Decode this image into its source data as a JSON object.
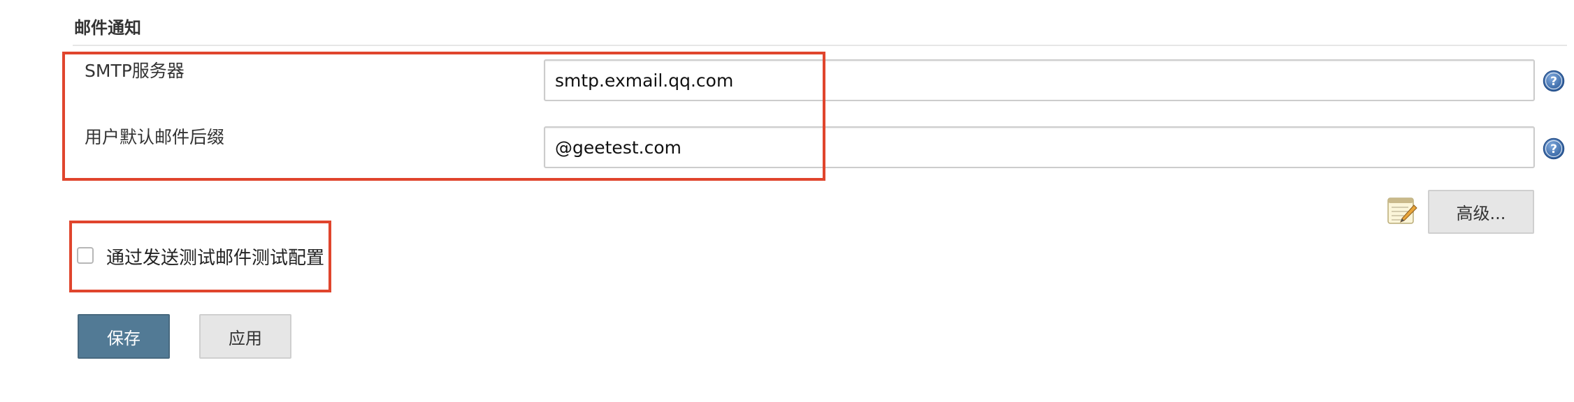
{
  "section": {
    "title": "邮件通知"
  },
  "smtp": {
    "label": "SMTP服务器",
    "value": "smtp.exmail.qq.com"
  },
  "suffix": {
    "label": "用户默认邮件后缀",
    "value": "@geetest.com"
  },
  "help": {
    "glyph": "?"
  },
  "advanced": {
    "label": "高级..."
  },
  "test_config": {
    "label": "通过发送测试邮件测试配置",
    "checked": false
  },
  "actions": {
    "save_label": "保存",
    "apply_label": "应用"
  },
  "colors": {
    "highlight": "#e0452d",
    "primary_button": "#527a95",
    "secondary_button": "#e6e6e6",
    "help_icon": "#2f5f9e"
  }
}
